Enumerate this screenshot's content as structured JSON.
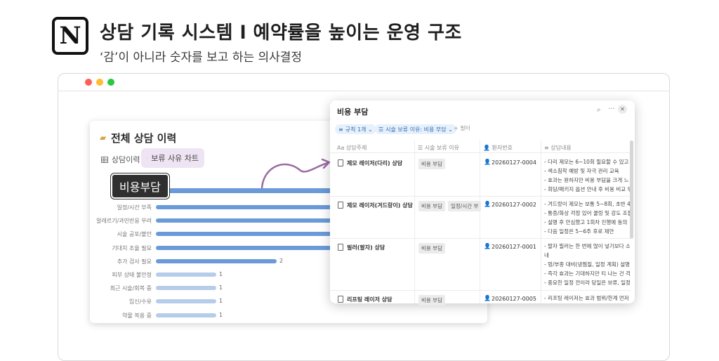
{
  "header": {
    "logo_letter": "N",
    "title": "상담 기록 시스템 l 예약률을 높이는 운영 구조",
    "subtitle": "‘감’이 아니라 숫자를 보고 하는 의사결정"
  },
  "browser": {
    "dots": [
      "#ff5f57",
      "#febc2e",
      "#28c840"
    ]
  },
  "chart_card": {
    "title": "전체 상담 이력",
    "tabs": [
      {
        "label": "상담이력",
        "icon": "table-icon"
      },
      {
        "label": "보류 사유 차트",
        "icon": "clock-icon"
      }
    ],
    "callout": "비용부담"
  },
  "chart_data": {
    "type": "bar",
    "orientation": "horizontal",
    "categories": [
      "일정/시간 부족",
      "알레르기/과민반응 우려",
      "시술 공포/불안",
      "기대치 조율 필요",
      "추가 검사 필요",
      "피부 상태 불안정",
      "최근 시술/회복 중",
      "임신/수유",
      "약물 복용 중"
    ],
    "values": [
      null,
      null,
      null,
      null,
      2,
      1,
      1,
      1,
      1
    ],
    "value_labels": [
      "",
      "",
      "",
      "",
      "2",
      "1",
      "1",
      "1",
      "1"
    ],
    "colors": {
      "strong": "#6a9bd8",
      "light": "#b6cdea"
    }
  },
  "panel": {
    "title": "비용 부담",
    "filters": [
      {
        "label": "규칙 1개 ⌄"
      },
      {
        "label": "시술 보류 이유: 비용 부담 ⌄"
      }
    ],
    "add_filter": "+ 필터",
    "columns": [
      "상담주제",
      "시술 보류 이유",
      "환자번호",
      "상담내용"
    ],
    "rows": [
      {
        "title": "제모 레이저(다리) 상담",
        "tags": [
          "비용 부담"
        ],
        "pid": "20260127-0004",
        "notes": [
          "- 다리 제모는 6~10회 필요할 수 있고 반",
          "- 색소침착 예방 및 자극 관리 교육",
          "- 효과는 원하지만 비용 부담을 크게 느",
          "- 회당/패키지 옵션 안내 후 비용 비교 뒤"
        ]
      },
      {
        "title": "제모 레이저(겨드랑이) 상담",
        "tags": [
          "비용 부담",
          "일정/시간 부"
        ],
        "pid": "20260127-0002",
        "notes": [
          "- 겨드랑이 제모는 보통 5~8회, 초반 4~",
          "- 통증/화상 걱정 있어 쿨링 및 강도 조절",
          "- 설명 후 안심했고 1회차 진행에 동의",
          "- 다음 일정은 5~6주 후로 제안"
        ]
      },
      {
        "title": "필러(팔자) 상담",
        "tags": [
          "비용 부담"
        ],
        "pid": "20260127-0001",
        "notes": [
          "- 팔자 필러는 한 번에 많이 넣기보다 소",
          "내",
          "- 멍/부종 대비(냉찜질, 일정 계획) 설명",
          "- 즉각 효과는 기대하지만 티 나는 건 걱",
          "- 중요한 일정 전이라 당일은 보류, 일정"
        ]
      },
      {
        "title": "리프팅 레이저 상담",
        "tags": [
          "비용 부담"
        ],
        "pid": "20260127-0005",
        "notes": [
          "- 리프팅 레이저는 효과 범위/한계 먼저"
        ]
      }
    ]
  }
}
